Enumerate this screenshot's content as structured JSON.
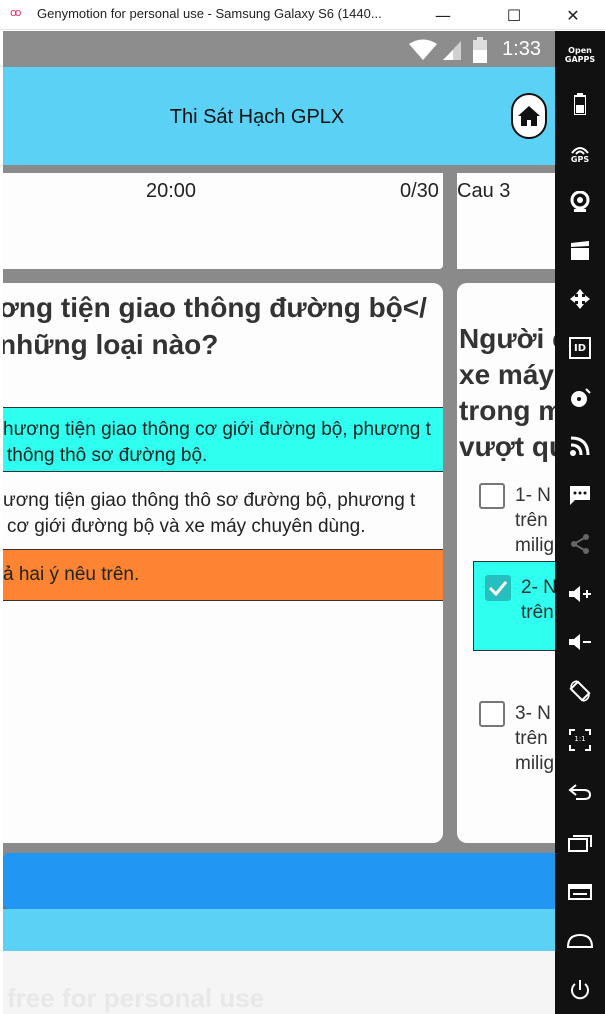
{
  "window": {
    "logo_glyph": "oo",
    "title": "Genymotion for personal use - Samsung Galaxy S6 (1440...",
    "minimize_glyph": "—",
    "maximize_glyph": "☐",
    "close_glyph": "✕"
  },
  "status_bar": {
    "time": "1:33"
  },
  "app_bar": {
    "title": "Thi Sát Hạch GPLX"
  },
  "timer": {
    "time_left": "20:00",
    "progress": "0/30",
    "next_label": "Cau 3"
  },
  "question_current": {
    "lines": [
      "ơng tiện giao thông đường bộ</",
      "những loại nào?"
    ],
    "answers": [
      {
        "lines": [
          "hương tiện giao thông cơ giới đường bộ, phương t",
          "thông thô sơ đường bộ."
        ],
        "state": "highlighted"
      },
      {
        "lines": [
          "ương tiện giao thông thô sơ đường bộ, phương t",
          "cơ giới đường bộ và xe máy chuyên dùng."
        ],
        "state": "normal"
      },
      {
        "lines": [
          "ả hai ý nêu trên."
        ],
        "state": "correct"
      }
    ]
  },
  "question_next": {
    "lines": [
      "Người c",
      "xe máy",
      "trong m",
      "vượt qu"
    ],
    "options": [
      {
        "lines": [
          "1- N",
          "trên",
          "milig"
        ],
        "checked": false
      },
      {
        "lines": [
          "2- N",
          "trên"
        ],
        "checked": true
      },
      {
        "lines": [
          "3- N",
          "trên",
          "milig"
        ],
        "checked": false
      }
    ]
  },
  "footer": {
    "watermark": "free for personal use"
  },
  "sidebar": {
    "opengapps_label": "Open\nGAPPS",
    "gps_label": "GPS",
    "id_label": "ID",
    "ratio_label": "1:1"
  },
  "colors": {
    "app_bar": "#5bd2f5",
    "answer_highlight": "#2effef",
    "answer_correct": "#fd8432",
    "checkbox_checked": "#26bfc0",
    "bottom_bar": "#2196f3"
  }
}
